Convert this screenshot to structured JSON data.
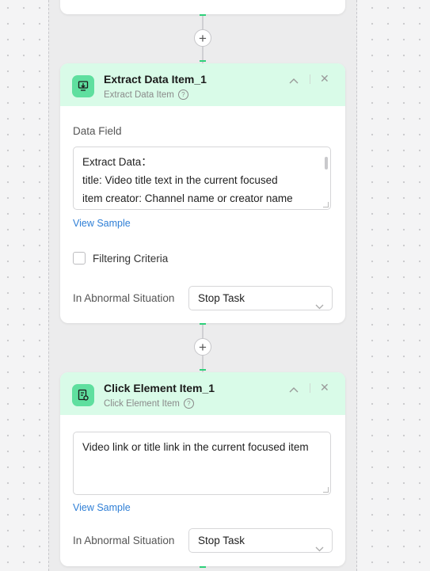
{
  "flow": {
    "add_step_label": "+",
    "steps": [
      {
        "title": "Extract Data Item_1",
        "subtitle": "Extract Data Item",
        "field_label": "Data Field",
        "field_value_lines": [
          "Extract Data：",
          "title: Video title text in the current focused",
          "item creator: Channel name or creator name"
        ],
        "view_sample": "View Sample",
        "filter_label": "Filtering Criteria",
        "filter_checked": false,
        "abnormal_label": "In Abnormal Situation",
        "abnormal_value": "Stop Task"
      },
      {
        "title": "Click Element Item_1",
        "subtitle": "Click Element Item",
        "field_value": "Video link or title link in the current focused item",
        "view_sample": "View Sample",
        "abnormal_label": "In Abnormal Situation",
        "abnormal_value": "Stop Task"
      }
    ]
  },
  "icons": {
    "extract": "extract-data-icon",
    "click": "click-element-icon",
    "help": "help-circle-icon",
    "collapse": "chevron-up-icon",
    "close": "close-icon",
    "dropdown": "chevron-down-icon",
    "add": "plus-icon"
  },
  "colors": {
    "header_bg": "#d9fbe8",
    "icon_bg": "#5fdf9f",
    "link": "#2f7fd6",
    "connector_accent": "#2fd07a"
  }
}
